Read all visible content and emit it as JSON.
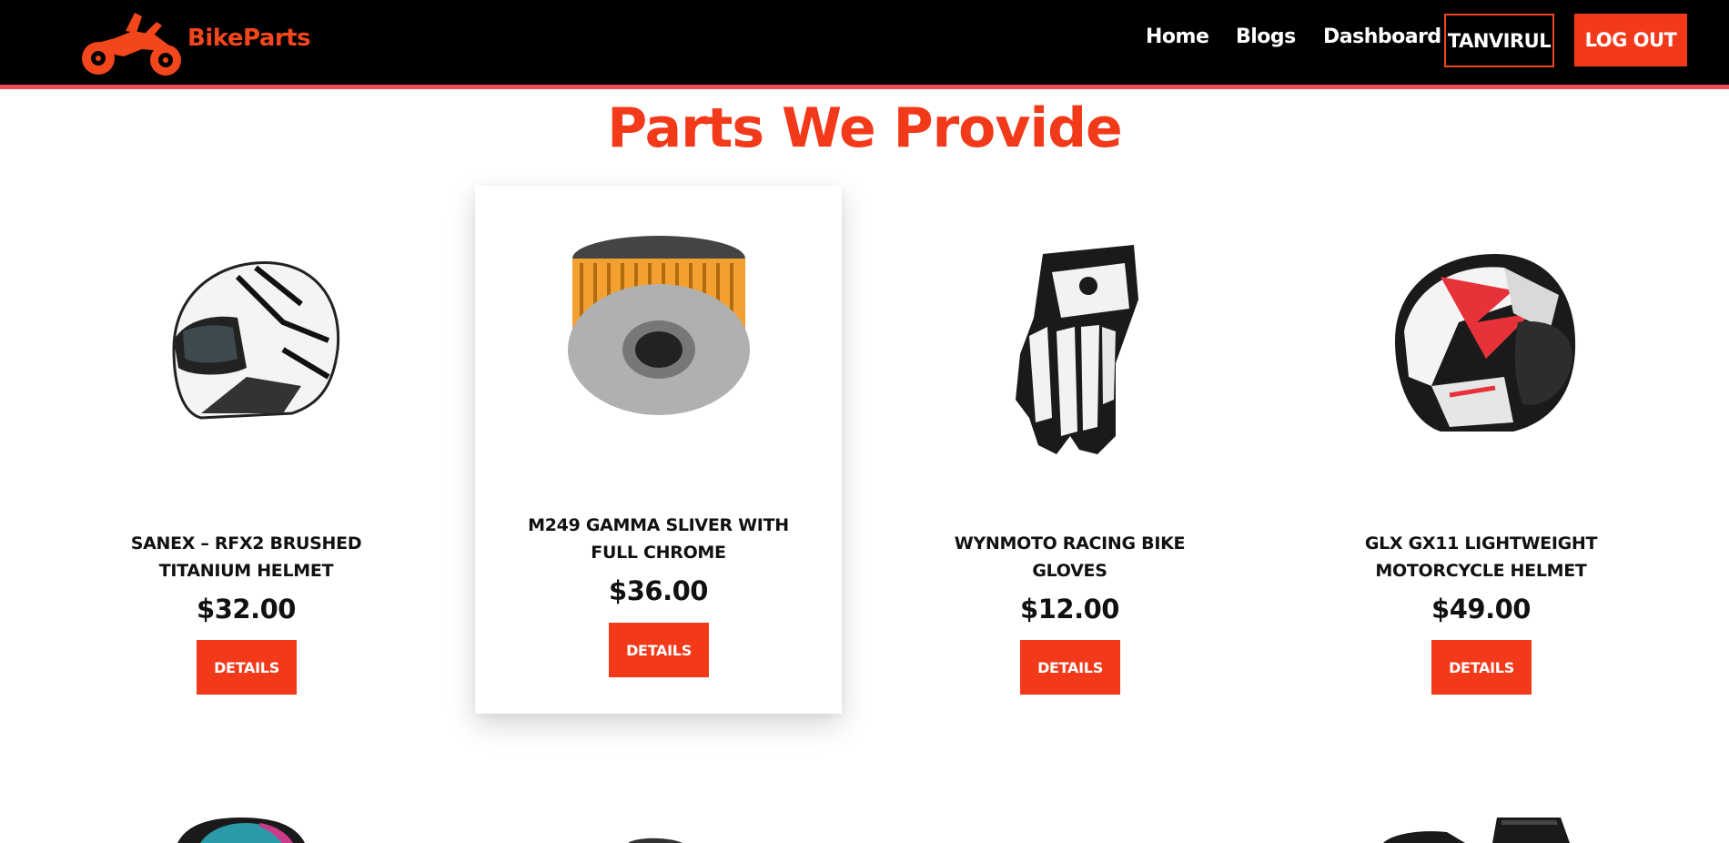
{
  "navbar": {
    "brand": "BikeParts",
    "links": [
      "Home",
      "Blogs",
      "Dashboard"
    ],
    "user": "TANVIRUL",
    "logout": "LOG OUT"
  },
  "section": {
    "title": "Parts We Provide"
  },
  "products": [
    {
      "name": "SANEX – RFX2 BRUSHED TITANIUM HELMET",
      "price": "$32.00",
      "button": "DETAILS",
      "icon": "white-helmet-image"
    },
    {
      "name": "M249 GAMMA SLIVER WITH FULL CHROME",
      "price": "$36.00",
      "button": "DETAILS",
      "icon": "oil-filter-image"
    },
    {
      "name": "WYNMOTO RACING BIKE GLOVES",
      "price": "$12.00",
      "button": "DETAILS",
      "icon": "racing-gloves-image"
    },
    {
      "name": "GLX GX11 LIGHTWEIGHT MOTORCYCLE HELMET",
      "price": "$49.00",
      "button": "DETAILS",
      "icon": "red-helmet-image"
    }
  ],
  "colors": {
    "accent": "#f2391a",
    "navbar_bg": "#000000",
    "navbar_border": "#ee4b55",
    "text": "#111111"
  }
}
